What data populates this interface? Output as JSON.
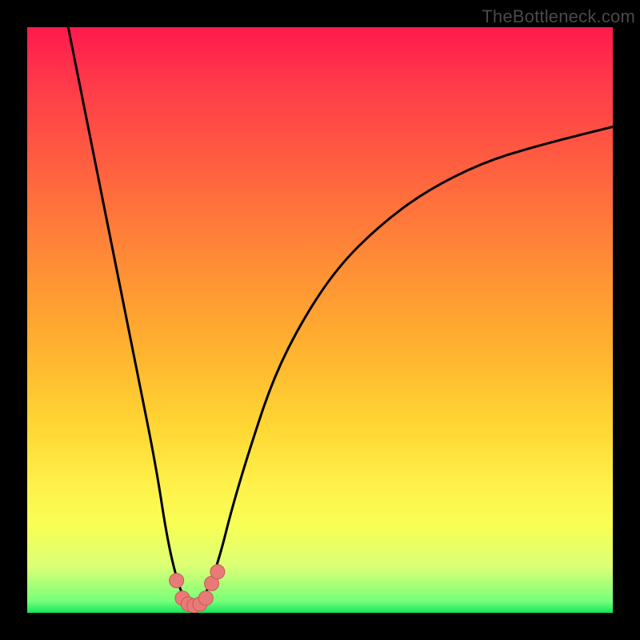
{
  "attribution": "TheBottleneck.com",
  "colors": {
    "frame_bg": "#000000",
    "gradient_top": "#ff1a4d",
    "gradient_bottom": "#14e65b",
    "curve_stroke": "#000000",
    "marker_fill": "#e87a78",
    "marker_stroke": "#c85a56"
  },
  "chart_data": {
    "type": "line",
    "title": "",
    "xlabel": "",
    "ylabel": "",
    "xlim": [
      0,
      100
    ],
    "ylim": [
      0,
      100
    ],
    "grid": false,
    "series": [
      {
        "name": "curve",
        "x": [
          7,
          10,
          14,
          17,
          19,
          22,
          24,
          26,
          27.5,
          29,
          31,
          33,
          35,
          38,
          42,
          47,
          53,
          60,
          68,
          78,
          88,
          100
        ],
        "y": [
          100,
          85,
          65,
          50,
          40,
          25,
          12,
          4,
          1.5,
          1.5,
          4,
          10,
          18,
          28,
          40,
          50,
          59,
          66,
          72,
          77,
          80,
          83
        ]
      }
    ],
    "markers": {
      "name": "highlight-points",
      "x": [
        25.5,
        26.5,
        27.5,
        28.5,
        29.5,
        30.5,
        31.5,
        32.5
      ],
      "y": [
        5.5,
        2.5,
        1.5,
        1.2,
        1.5,
        2.5,
        5,
        7
      ]
    }
  }
}
